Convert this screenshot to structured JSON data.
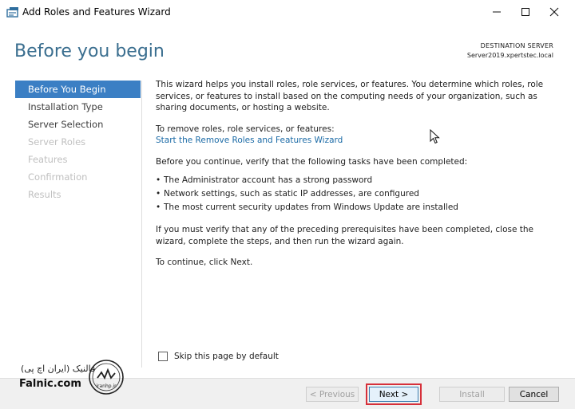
{
  "window": {
    "title": "Add Roles and Features Wizard"
  },
  "header": {
    "page_title": "Before you begin",
    "destination_label": "DESTINATION SERVER",
    "destination_server": "Server2019.xpertstec.local"
  },
  "nav": {
    "items": [
      {
        "label": "Before You Begin",
        "state": "active"
      },
      {
        "label": "Installation Type",
        "state": "enabled"
      },
      {
        "label": "Server Selection",
        "state": "enabled"
      },
      {
        "label": "Server Roles",
        "state": "disabled"
      },
      {
        "label": "Features",
        "state": "disabled"
      },
      {
        "label": "Confirmation",
        "state": "disabled"
      },
      {
        "label": "Results",
        "state": "disabled"
      }
    ]
  },
  "main": {
    "intro": "This wizard helps you install roles, role services, or features. You determine which roles, role services, or features to install based on the computing needs of your organization, such as sharing documents, or hosting a website.",
    "remove_label": "To remove roles, role services, or features:",
    "remove_link": "Start the Remove Roles and Features Wizard",
    "verify_text": "Before you continue, verify that the following tasks have been completed:",
    "tasks": [
      "The Administrator account has a strong password",
      "Network settings, such as static IP addresses, are configured",
      "The most current security updates from Windows Update are installed"
    ],
    "prereq_text": "If you must verify that any of the preceding prerequisites have been completed, close the wizard, complete the steps, and then run the wizard again.",
    "continue_text": "To continue, click Next."
  },
  "options": {
    "skip_label": "Skip this page by default",
    "skip_checked": false
  },
  "footer": {
    "previous_label": "< Previous",
    "next_label": "Next >",
    "install_label": "Install",
    "cancel_label": "Cancel"
  },
  "watermark": {
    "persian_text": "فالنیک (ایران اچ پی)",
    "brand": "Falnic.com",
    "logo_text": "iranhp.ir"
  },
  "colors": {
    "accent": "#3b7fc4",
    "heading": "#3a6e8f",
    "link": "#1a6aa6",
    "highlight": "#d6303a"
  }
}
